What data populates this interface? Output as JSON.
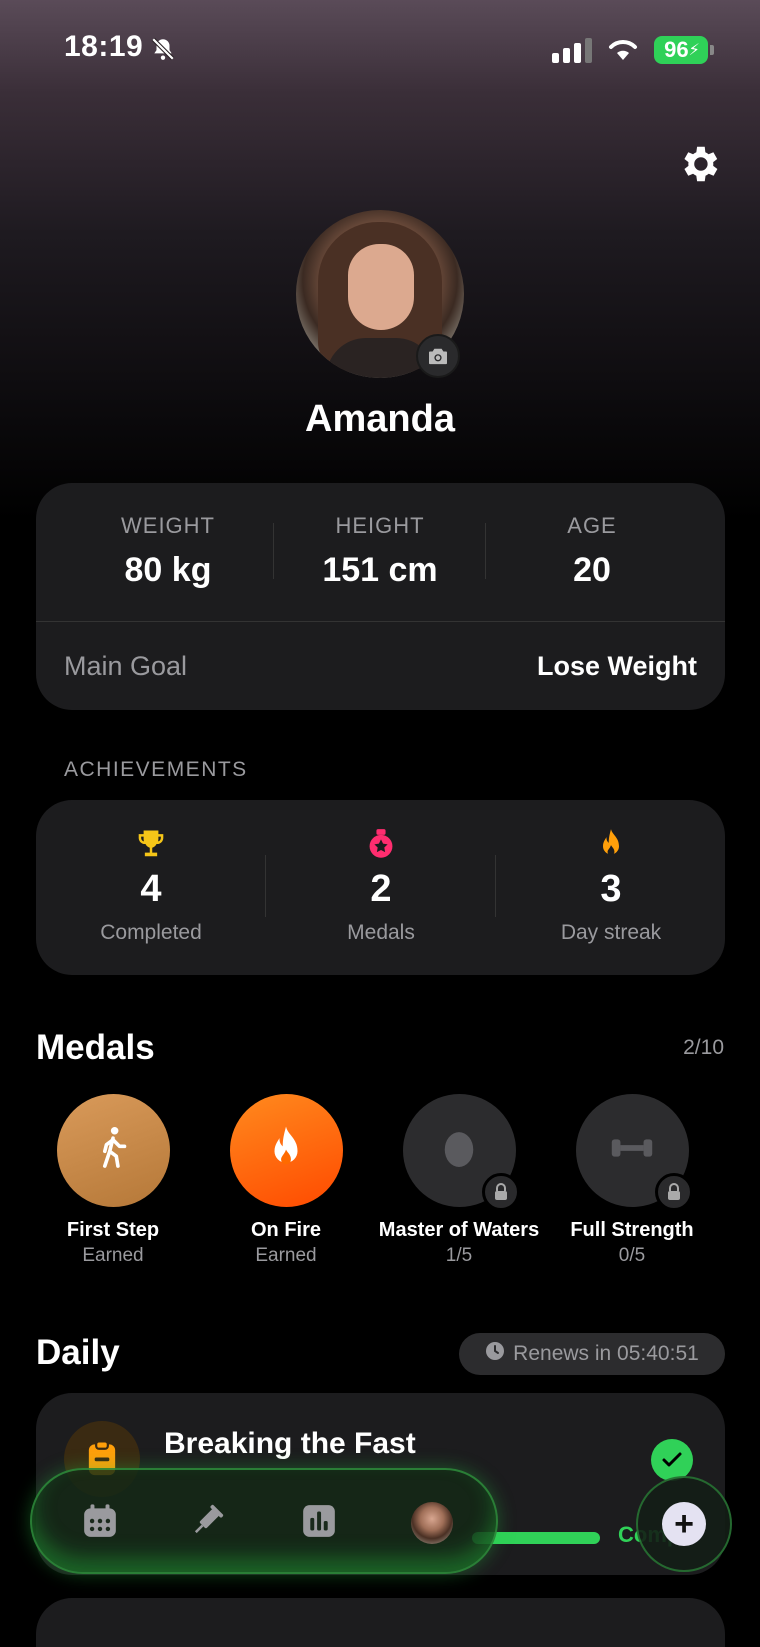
{
  "status_bar": {
    "time": "18:19",
    "battery": "96"
  },
  "profile": {
    "name": "Amanda"
  },
  "stats": {
    "weight_label": "WEIGHT",
    "weight_value": "80 kg",
    "height_label": "HEIGHT",
    "height_value": "151 cm",
    "age_label": "AGE",
    "age_value": "20",
    "goal_label": "Main Goal",
    "goal_value": "Lose Weight"
  },
  "achievements": {
    "caption": "ACHIEVEMENTS",
    "items": [
      {
        "number": "4",
        "label": "Completed",
        "icon": "trophy-icon",
        "color": "#f5c518"
      },
      {
        "number": "2",
        "label": "Medals",
        "icon": "medal-icon",
        "color": "#ff2d6f"
      },
      {
        "number": "3",
        "label": "Day streak",
        "icon": "flame-icon",
        "color": "#ff9f0a"
      }
    ]
  },
  "medals": {
    "title": "Medals",
    "count": "2/10",
    "items": [
      {
        "name": "First Step",
        "status": "Earned",
        "icon": "walking-person-icon",
        "color": "#c98a4b"
      },
      {
        "name": "On Fire",
        "status": "Earned",
        "icon": "flame-icon",
        "color": "#ff6a00"
      },
      {
        "name": "Master of Waters",
        "status": "1/5",
        "icon": "water-drop-icon",
        "locked": true
      },
      {
        "name": "Full Strength",
        "status": "0/5",
        "icon": "dumbbell-icon",
        "locked": true
      }
    ]
  },
  "daily": {
    "title": "Daily",
    "renews": "Renews in 05:40:51",
    "task_title": "Breaking the Fast",
    "task_status": "Comp"
  },
  "tabbar": {
    "items": [
      "calendar-icon",
      "syringe-icon",
      "bar-chart-icon",
      "profile-avatar"
    ],
    "accent": "#30d158"
  }
}
